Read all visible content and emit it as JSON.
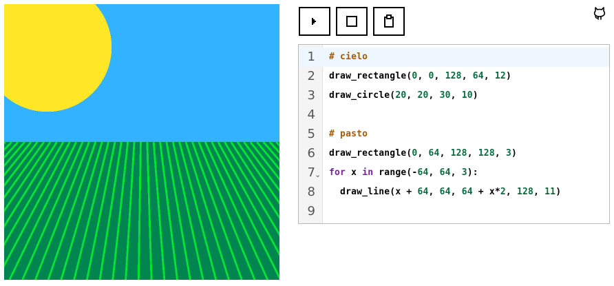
{
  "toolbar": {
    "buttons": [
      {
        "name": "run-button",
        "icon": "play-icon"
      },
      {
        "name": "stop-button",
        "icon": "stop-icon"
      },
      {
        "name": "copy-button",
        "icon": "clipboard-icon"
      }
    ]
  },
  "header": {
    "github_icon": "github-icon"
  },
  "canvas": {
    "sky_color": "#33b2ff",
    "sun_color": "#ffe627",
    "grass_color": "#008450",
    "grass_line_color": "#00e436"
  },
  "editor": {
    "active_line": 1,
    "lines": [
      {
        "number": "1",
        "tokens": [
          {
            "t": "# cielo",
            "c": "comment"
          }
        ]
      },
      {
        "number": "2",
        "tokens": [
          {
            "t": "draw_rectangle(",
            "c": "default"
          },
          {
            "t": "0",
            "c": "number"
          },
          {
            "t": ", ",
            "c": "default"
          },
          {
            "t": "0",
            "c": "number"
          },
          {
            "t": ", ",
            "c": "default"
          },
          {
            "t": "128",
            "c": "number"
          },
          {
            "t": ", ",
            "c": "default"
          },
          {
            "t": "64",
            "c": "number"
          },
          {
            "t": ", ",
            "c": "default"
          },
          {
            "t": "12",
            "c": "number"
          },
          {
            "t": ")",
            "c": "default"
          }
        ]
      },
      {
        "number": "3",
        "tokens": [
          {
            "t": "draw_circle(",
            "c": "default"
          },
          {
            "t": "20",
            "c": "number"
          },
          {
            "t": ", ",
            "c": "default"
          },
          {
            "t": "20",
            "c": "number"
          },
          {
            "t": ", ",
            "c": "default"
          },
          {
            "t": "30",
            "c": "number"
          },
          {
            "t": ", ",
            "c": "default"
          },
          {
            "t": "10",
            "c": "number"
          },
          {
            "t": ")",
            "c": "default"
          }
        ]
      },
      {
        "number": "4",
        "tokens": []
      },
      {
        "number": "5",
        "tokens": [
          {
            "t": "# pasto",
            "c": "comment"
          }
        ]
      },
      {
        "number": "6",
        "tokens": [
          {
            "t": "draw_rectangle(",
            "c": "default"
          },
          {
            "t": "0",
            "c": "number"
          },
          {
            "t": ", ",
            "c": "default"
          },
          {
            "t": "64",
            "c": "number"
          },
          {
            "t": ", ",
            "c": "default"
          },
          {
            "t": "128",
            "c": "number"
          },
          {
            "t": ", ",
            "c": "default"
          },
          {
            "t": "128",
            "c": "number"
          },
          {
            "t": ", ",
            "c": "default"
          },
          {
            "t": "3",
            "c": "number"
          },
          {
            "t": ")",
            "c": "default"
          }
        ]
      },
      {
        "number": "7",
        "fold": "⌄",
        "tokens": [
          {
            "t": "for",
            "c": "keyword"
          },
          {
            "t": " x ",
            "c": "default"
          },
          {
            "t": "in",
            "c": "keyword"
          },
          {
            "t": " range(-",
            "c": "default"
          },
          {
            "t": "64",
            "c": "number"
          },
          {
            "t": ", ",
            "c": "default"
          },
          {
            "t": "64",
            "c": "number"
          },
          {
            "t": ", ",
            "c": "default"
          },
          {
            "t": "3",
            "c": "number"
          },
          {
            "t": "):",
            "c": "default"
          }
        ]
      },
      {
        "number": "8",
        "tokens": [
          {
            "t": "  draw_line(x + ",
            "c": "default"
          },
          {
            "t": "64",
            "c": "number"
          },
          {
            "t": ", ",
            "c": "default"
          },
          {
            "t": "64",
            "c": "number"
          },
          {
            "t": ", ",
            "c": "default"
          },
          {
            "t": "64",
            "c": "number"
          },
          {
            "t": " + x*",
            "c": "default"
          },
          {
            "t": "2",
            "c": "number"
          },
          {
            "t": ", ",
            "c": "default"
          },
          {
            "t": "128",
            "c": "number"
          },
          {
            "t": ", ",
            "c": "default"
          },
          {
            "t": "11",
            "c": "number"
          },
          {
            "t": ")",
            "c": "default"
          }
        ]
      },
      {
        "number": "9",
        "tokens": []
      }
    ]
  }
}
